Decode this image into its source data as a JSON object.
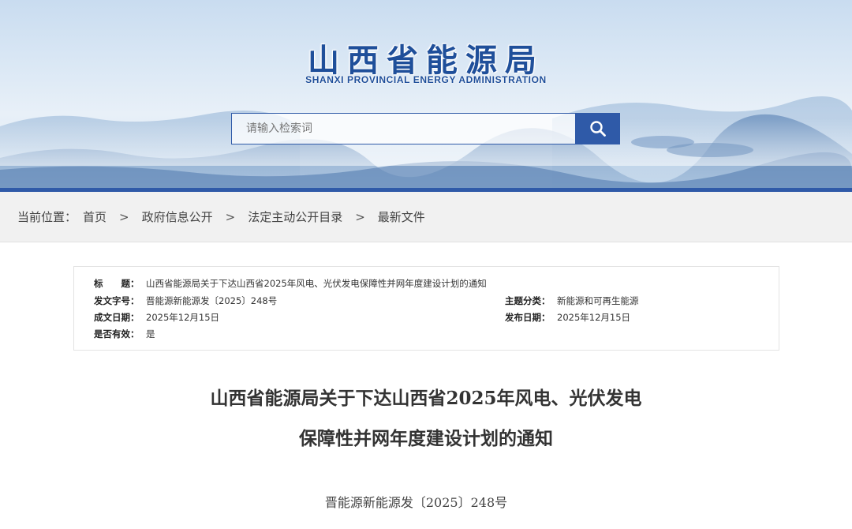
{
  "header": {
    "title": "山西省能源局",
    "subtitle": "SHANXI PROVINCIAL ENERGY ADMINISTRATION",
    "search": {
      "placeholder": "请输入检索词",
      "value": ""
    },
    "icons": {
      "search": "search-icon"
    },
    "accent_color": "#2f5aa8"
  },
  "breadcrumb": {
    "lead": "当前位置：",
    "items": [
      "首页",
      "政府信息公开",
      "法定主动公开目录",
      "最新文件"
    ],
    "separator": ">"
  },
  "info": {
    "title_label": "标　　题：",
    "title_value": "山西省能源局关于下达山西省2025年风电、光伏发电保障性并网年度建设计划的通知",
    "doc_no_label": "发文字号：",
    "doc_no_value": "晋能源新能源发〔2025〕248号",
    "topic_label": "主题分类：",
    "topic_value": "新能源和可再生能源",
    "written_label": "成文日期：",
    "written_value": "2025年12月15日",
    "published_label": "发布日期：",
    "published_value": "2025年12月15日",
    "valid_label": "是否有效：",
    "valid_value": "是"
  },
  "document": {
    "title_line1": "山西省能源局关于下达山西省2025年风电、光伏发电",
    "title_line2": "保障性并网年度建设计划的通知",
    "doc_number": "晋能源新能源发〔2025〕248号"
  }
}
